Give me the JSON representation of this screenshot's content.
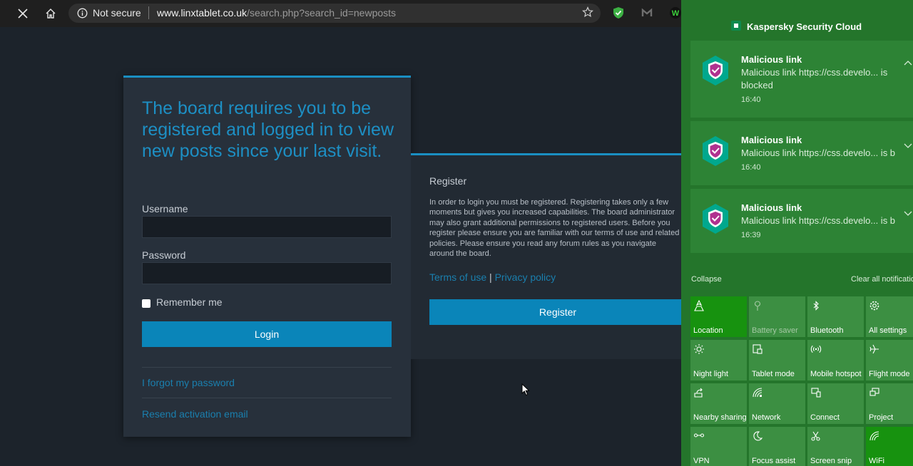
{
  "browser": {
    "security_label": "Not secure",
    "url_host": "www.linxtablet.co.uk",
    "url_path": "/search.php?search_id=newposts"
  },
  "login": {
    "title": "The board requires you to be registered and logged in to view new posts since your last visit.",
    "username_label": "Username",
    "password_label": "Password",
    "remember_label": "Remember me",
    "login_button": "Login",
    "forgot_link": "I forgot my password",
    "resend_link": "Resend activation email"
  },
  "register": {
    "title": "Register",
    "text": "In order to login you must be registered. Registering takes only a few moments but gives you increased capabilities. The board administrator may also grant additional permissions to registered users. Before you register please ensure you are familiar with our terms of use and related policies. Please ensure you read any forum rules as you navigate around the board.",
    "terms_link": "Terms of use",
    "separator": "|",
    "privacy_link": "Privacy policy",
    "register_button": "Register"
  },
  "action_center": {
    "app_name": "Kaspersky Security Cloud",
    "notifications": [
      {
        "title": "Malicious link",
        "body": "Malicious link https://css.develo... is blocked",
        "time": "16:40"
      },
      {
        "title": "Malicious link",
        "body": "Malicious link https://css.develo... is b",
        "time": "16:40"
      },
      {
        "title": "Malicious link",
        "body": "Malicious link https://css.develo... is b",
        "time": "16:39"
      }
    ],
    "collapse_label": "Collapse",
    "clear_label": "Clear all notificatio",
    "tiles": [
      {
        "label": "Location",
        "icon": "location-icon"
      },
      {
        "label": "Battery saver",
        "icon": "battery-saver-icon"
      },
      {
        "label": "Bluetooth",
        "icon": "bluetooth-icon"
      },
      {
        "label": "All settings",
        "icon": "gear-icon"
      },
      {
        "label": "Night light",
        "icon": "night-light-icon"
      },
      {
        "label": "Tablet mode",
        "icon": "tablet-mode-icon"
      },
      {
        "label": "Mobile hotspot",
        "icon": "hotspot-icon"
      },
      {
        "label": "Flight mode",
        "icon": "airplane-icon"
      },
      {
        "label": "Nearby sharing",
        "icon": "nearby-sharing-icon"
      },
      {
        "label": "Network",
        "icon": "network-icon"
      },
      {
        "label": "Connect",
        "icon": "connect-icon"
      },
      {
        "label": "Project",
        "icon": "project-icon"
      },
      {
        "label": "VPN",
        "icon": "vpn-icon"
      },
      {
        "label": "Focus assist",
        "icon": "focus-assist-icon"
      },
      {
        "label": "Screen snip",
        "icon": "screen-snip-icon"
      },
      {
        "label": "WiFi",
        "icon": "wifi-icon"
      }
    ]
  },
  "colors": {
    "accent": "#1a8fc2",
    "button": "#0a85b9",
    "action_center_bg": "#24752b",
    "tile_on": "#17920f"
  }
}
